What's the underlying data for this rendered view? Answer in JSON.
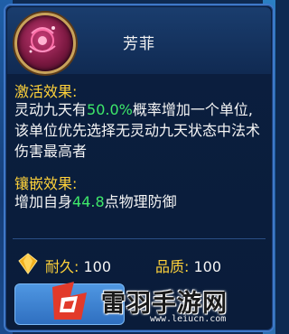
{
  "item": {
    "name": "芳菲"
  },
  "activation": {
    "heading": "激活效果:",
    "text_before": "灵动九天有",
    "value": "50.0%",
    "text_after": "概率增加一个单位,该单位优先选择无灵动九天状态中法术伤害最高者"
  },
  "inlay": {
    "heading": "镶嵌效果:",
    "text_before": "增加自身",
    "value": "44.8",
    "text_after": "点物理防御"
  },
  "stats": {
    "durability_label": "耐久:",
    "durability_value": "100",
    "quality_label": "品质:",
    "quality_value": "100"
  },
  "watermark": {
    "title": "雷羽手游网",
    "url": "www.leiucn.com"
  },
  "colors": {
    "heading": "#ffd23a",
    "highlight": "#3ee86a",
    "panel": "#0b1f3f",
    "border": "#3f78c8"
  },
  "icons": {
    "item_icon": "magic-orb-icon",
    "durability_icon": "diamond-icon",
    "watermark_logo": "watermark-logo-icon"
  }
}
